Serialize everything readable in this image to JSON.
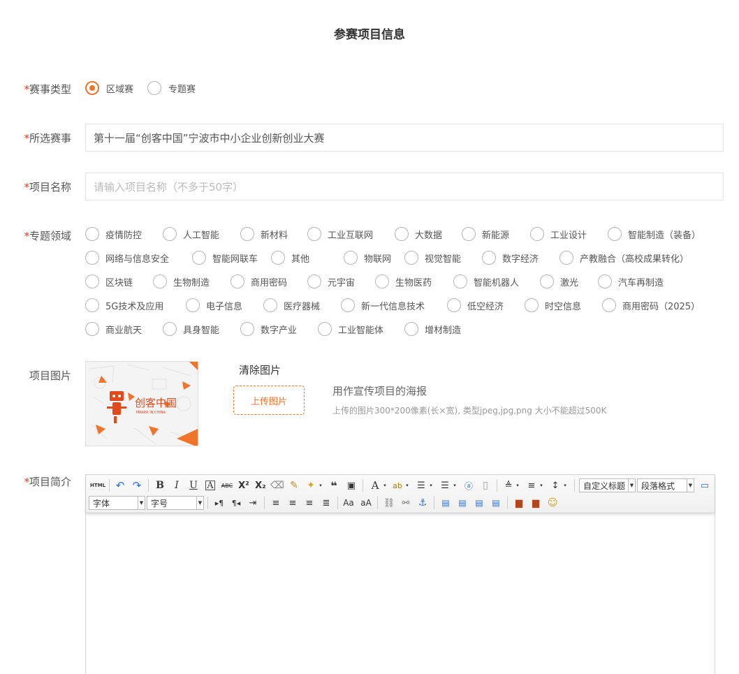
{
  "page": {
    "title": "参赛项目信息"
  },
  "labels": {
    "type": "赛事类型",
    "contest": "所选赛事",
    "name": "项目名称",
    "field": "专题领域",
    "image": "项目图片",
    "intro": "项目简介",
    "required_mark": "*"
  },
  "contest_type": {
    "options": [
      {
        "label": "区域赛",
        "selected": true
      },
      {
        "label": "专题赛",
        "selected": false
      }
    ]
  },
  "contest": {
    "value": "第十一届“创客中国”宁波市中小企业创新创业大赛"
  },
  "project_name": {
    "placeholder": "请输入项目名称（不多于50字）"
  },
  "topics": {
    "rows": [
      [
        "疫情防控",
        "人工智能",
        "新材料",
        "工业互联网",
        "大数据",
        "新能源",
        "工业设计",
        "智能制造（装备）"
      ],
      [
        "网络与信息安全",
        "智能网联车",
        "其他",
        "物联网",
        "视觉智能",
        "数字经济",
        "产教融合（高校成果转化）"
      ],
      [
        "区块链",
        "生物制造",
        "商用密码",
        "元宇宙",
        "生物医药",
        "智能机器人",
        "激光",
        "汽车再制造"
      ],
      [
        "5G技术及应用",
        "电子信息",
        "医疗器械",
        "新一代信息技术",
        "低空经济",
        "时空信息",
        "商用密码（2025）"
      ],
      [
        "商业航天",
        "具身智能",
        "数字产业",
        "工业智能体",
        "增材制造"
      ]
    ]
  },
  "image": {
    "clear_label": "清除图片",
    "upload_label": "上传图片",
    "hint_title": "用作宣传项目的海报",
    "hint_sub": "上传的图片300*200像素(长×宽), 类型jpeg,jpg,png 大小不能超过500K",
    "poster_text": "创客中国",
    "poster_sub": "MAKER IN CHINA"
  },
  "editor": {
    "html_label": "HTML",
    "heading_select": "自定义标题",
    "paragraph_select": "段落格式",
    "font_select": "字体",
    "size_select": "字号"
  },
  "colors": {
    "accent": "#f0742a",
    "required": "#e03c20"
  }
}
